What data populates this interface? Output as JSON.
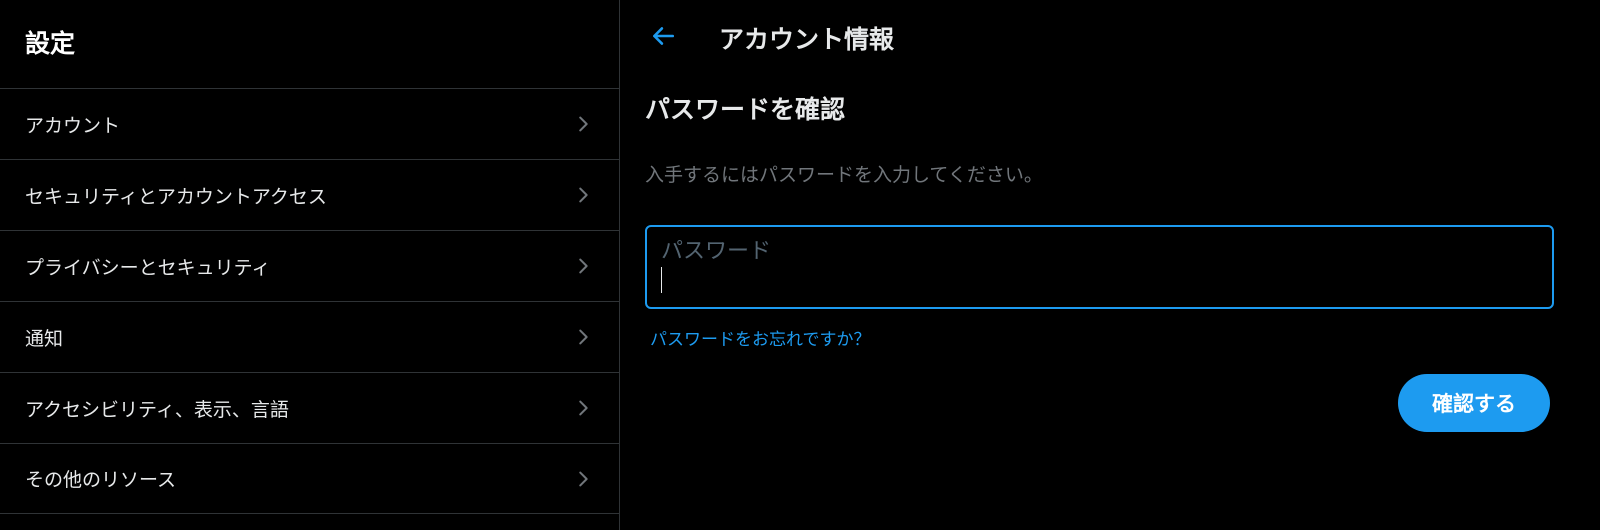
{
  "sidebar": {
    "title": "設定",
    "items": [
      {
        "label": "アカウント"
      },
      {
        "label": "セキュリティとアカウントアクセス"
      },
      {
        "label": "プライバシーとセキュリティ"
      },
      {
        "label": "通知"
      },
      {
        "label": "アクセシビリティ、表示、言語"
      },
      {
        "label": "その他のリソース"
      }
    ]
  },
  "main": {
    "title": "アカウント情報",
    "section_heading": "パスワードを確認",
    "section_desc": "入手するにはパスワードを入力してください。",
    "password_label": "パスワード",
    "password_value": "",
    "forgot_link": "パスワードをお忘れですか？",
    "confirm_label": "確認する"
  },
  "colors": {
    "accent": "#1d9bf0",
    "bg": "#000000",
    "border": "#2f3336",
    "muted": "#71767b"
  }
}
